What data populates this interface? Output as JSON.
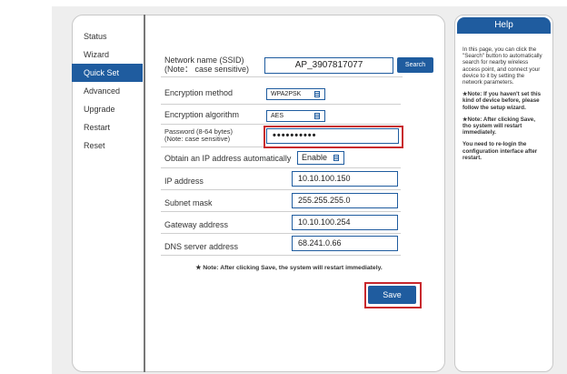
{
  "sidebar": {
    "items": [
      {
        "label": "Status",
        "active": false
      },
      {
        "label": "Wizard",
        "active": false
      },
      {
        "label": "Quick Set",
        "active": true
      },
      {
        "label": "Advanced",
        "active": false
      },
      {
        "label": "Upgrade",
        "active": false
      },
      {
        "label": "Restart",
        "active": false
      },
      {
        "label": "Reset",
        "active": false
      }
    ]
  },
  "form": {
    "ssid_label_1": "Network name (SSID)",
    "ssid_label_2": "(Note： case sensitive)",
    "ssid_value": "AP_3907817077",
    "search_label": "Search",
    "encryption_method_label": "Encryption method",
    "encryption_method_value": "WPA2PSK",
    "encryption_algorithm_label": "Encryption algorithm",
    "encryption_algorithm_value": "AES",
    "password_label_1": "Password (8-64 bytes)",
    "password_label_2": "(Note: case sensitive)",
    "password_value": "••••••••••",
    "obtain_ip_label": "Obtain an IP address automatically",
    "obtain_ip_value": "Enable",
    "ip_label": "IP address",
    "ip_value": "10.10.100.150",
    "subnet_label": "Subnet mask",
    "subnet_value": "255.255.255.0",
    "gateway_label": "Gateway address",
    "gateway_value": "10.10.100.254",
    "dns_label": "DNS server address",
    "dns_value": "68.241.0.66",
    "note": "★ Note: After clicking Save, the system will restart immediately.",
    "save_label": "Save"
  },
  "help": {
    "title": "Help",
    "p1": "In this page, you can click the \"Search\" button to automatically search for nearby wireless access point, and connect your device to it by setting the network parameters.",
    "p2": "★Note: If you haven't set this kind of device before, please follow the setup wizard.",
    "p3": "★Note:  After clicking Save, tho system will restart immediately.",
    "p4": "You need to re-login the configuration interface after restart."
  },
  "colors": {
    "accent": "#1f5c9f",
    "highlight": "#c8282d"
  }
}
